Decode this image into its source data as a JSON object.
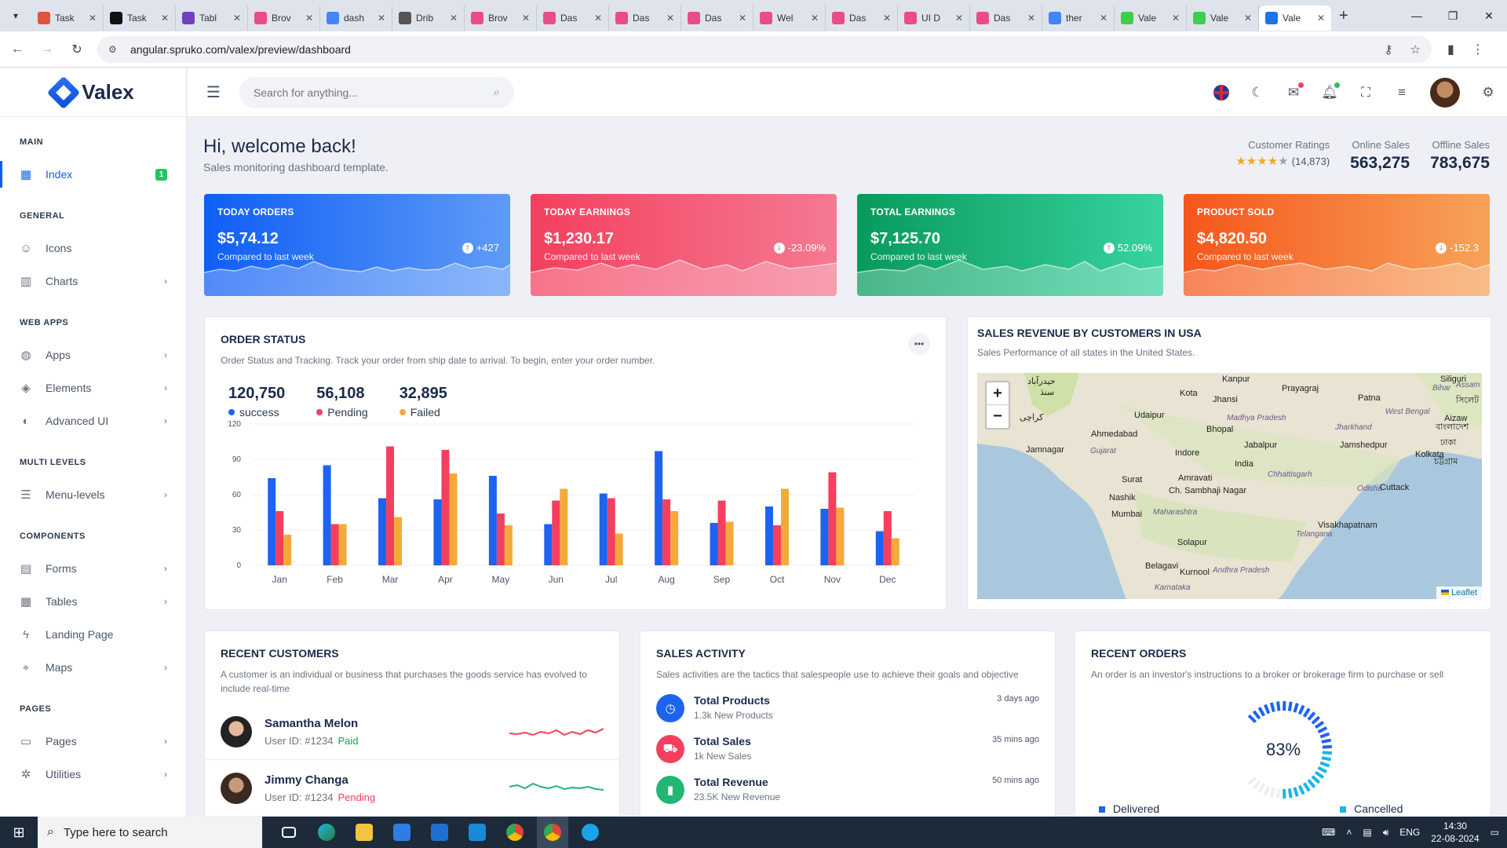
{
  "browser": {
    "tabs": [
      {
        "title": "Task",
        "color": "#e0533d"
      },
      {
        "title": "Task",
        "color": "#111111"
      },
      {
        "title": "Tabl",
        "color": "#6f42c1"
      },
      {
        "title": "Brov",
        "color": "#ea4c89"
      },
      {
        "title": "dash",
        "color": "#4285f4"
      },
      {
        "title": "Drib",
        "color": "#555555"
      },
      {
        "title": "Brov",
        "color": "#ea4c89"
      },
      {
        "title": "Das",
        "color": "#ea4c89"
      },
      {
        "title": "Das",
        "color": "#ea4c89"
      },
      {
        "title": "Das",
        "color": "#ea4c89"
      },
      {
        "title": "Wel",
        "color": "#ea4c89"
      },
      {
        "title": "Das",
        "color": "#ea4c89"
      },
      {
        "title": "UI D",
        "color": "#ea4c89"
      },
      {
        "title": "Das",
        "color": "#ea4c89"
      },
      {
        "title": "ther",
        "color": "#4285f4"
      },
      {
        "title": "Vale",
        "color": "#3ecf4a"
      },
      {
        "title": "Vale",
        "color": "#3ecf4a"
      },
      {
        "title": "Vale",
        "color": "#1a73e8",
        "active": true
      }
    ],
    "url": "angular.spruko.com/valex/preview/dashboard"
  },
  "sidebar": {
    "logo": "Valex",
    "sections": [
      {
        "title": "MAIN",
        "items": [
          {
            "label": "Index",
            "icon": "grid-icon",
            "active": true,
            "badge": "1"
          }
        ]
      },
      {
        "title": "GENERAL",
        "items": [
          {
            "label": "Icons",
            "icon": "smile-icon"
          },
          {
            "label": "Charts",
            "icon": "chart-icon",
            "chevron": true
          }
        ]
      },
      {
        "title": "WEB APPS",
        "items": [
          {
            "label": "Apps",
            "icon": "globe-icon",
            "chevron": true
          },
          {
            "label": "Elements",
            "icon": "layers-icon",
            "chevron": true
          },
          {
            "label": "Advanced UI",
            "icon": "palette-icon",
            "chevron": true
          }
        ]
      },
      {
        "title": "MULTI LEVELS",
        "items": [
          {
            "label": "Menu-levels",
            "icon": "server-icon",
            "chevron": true
          }
        ]
      },
      {
        "title": "COMPONENTS",
        "items": [
          {
            "label": "Forms",
            "icon": "file-icon",
            "chevron": true
          },
          {
            "label": "Tables",
            "icon": "table-icon",
            "chevron": true
          },
          {
            "label": "Landing Page",
            "icon": "bolt-icon"
          },
          {
            "label": "Maps",
            "icon": "pin-icon",
            "chevron": true
          }
        ]
      },
      {
        "title": "PAGES",
        "items": [
          {
            "label": "Pages",
            "icon": "book-icon",
            "chevron": true
          },
          {
            "label": "Utilities",
            "icon": "settings-icon",
            "chevron": true
          }
        ]
      }
    ]
  },
  "topbar": {
    "search_placeholder": "Search for anything..."
  },
  "header": {
    "title": "Hi, welcome back!",
    "subtitle": "Sales monitoring dashboard template.",
    "ratings_label": "Customer Ratings",
    "ratings_count": "(14,873)",
    "online_label": "Online Sales",
    "online_value": "563,275",
    "offline_label": "Offline Sales",
    "offline_value": "783,675"
  },
  "cards": [
    {
      "title": "TODAY ORDERS",
      "value": "$5,74.12",
      "sub": "Compared to last week",
      "delta": "+427",
      "dir": "up"
    },
    {
      "title": "TODAY EARNINGS",
      "value": "$1,230.17",
      "sub": "Compared to last week",
      "delta": "-23.09%",
      "dir": "down"
    },
    {
      "title": "TOTAL EARNINGS",
      "value": "$7,125.70",
      "sub": "Compared to last week",
      "delta": "52.09%",
      "dir": "up"
    },
    {
      "title": "PRODUCT SOLD",
      "value": "$4,820.50",
      "sub": "Compared to last week",
      "delta": "-152.3",
      "dir": "down"
    }
  ],
  "order_status": {
    "title": "ORDER STATUS",
    "desc": "Order Status and Tracking. Track your order from ship date to arrival. To begin, enter your order number.",
    "stats": [
      {
        "value": "120,750",
        "label": "success",
        "color": "#1e63f0"
      },
      {
        "value": "56,108",
        "label": "Pending",
        "color": "#f43f5e"
      },
      {
        "value": "32,895",
        "label": "Failed",
        "color": "#f6a93b"
      }
    ]
  },
  "chart_data": {
    "type": "bar",
    "categories": [
      "Jan",
      "Feb",
      "Mar",
      "Apr",
      "May",
      "Jun",
      "Jul",
      "Aug",
      "Sep",
      "Oct",
      "Nov",
      "Dec"
    ],
    "series": [
      {
        "name": "success",
        "color": "#1e63f0",
        "values": [
          74,
          85,
          57,
          56,
          76,
          35,
          61,
          97,
          36,
          50,
          48,
          29
        ]
      },
      {
        "name": "Pending",
        "color": "#f43f5e",
        "values": [
          46,
          35,
          101,
          98,
          44,
          55,
          57,
          56,
          55,
          34,
          79,
          46
        ]
      },
      {
        "name": "Failed",
        "color": "#f6a93b",
        "values": [
          26,
          35,
          41,
          78,
          34,
          65,
          27,
          46,
          37,
          65,
          49,
          23
        ]
      }
    ],
    "yticks": [
      0,
      30,
      60,
      90,
      120
    ],
    "ylim": [
      0,
      120
    ]
  },
  "map": {
    "title": "SALES REVENUE BY CUSTOMERS IN USA",
    "desc": "Sales Performance of all states in the United States.",
    "attribution": "Leaflet",
    "cities": [
      {
        "name": "Kanpur",
        "it": false
      },
      {
        "name": "Prayagraj",
        "it": false
      },
      {
        "name": "Siliguri",
        "it": false
      },
      {
        "name": "Assam",
        "it": true
      },
      {
        "name": "Bihar",
        "it": true
      },
      {
        "name": "Kota",
        "it": false
      },
      {
        "name": "Jhansi",
        "it": false
      },
      {
        "name": "Patna",
        "it": false
      },
      {
        "name": "সিলেট",
        "it": false
      },
      {
        "name": "Udaipur",
        "it": false
      },
      {
        "name": "Madhya Pradesh",
        "it": true
      },
      {
        "name": "Ahmedabad",
        "it": false
      },
      {
        "name": "Bhopal",
        "it": false
      },
      {
        "name": "Jharkhand",
        "it": true
      },
      {
        "name": "West Bengal",
        "it": true
      },
      {
        "name": "Jamnagar",
        "it": false
      },
      {
        "name": "Indore",
        "it": false
      },
      {
        "name": "Jabalpur",
        "it": false
      },
      {
        "name": "Jamshedpur",
        "it": false
      },
      {
        "name": "Kolkata",
        "it": false
      },
      {
        "name": "Gujarat",
        "it": true
      },
      {
        "name": "India",
        "it": false
      },
      {
        "name": "Amravati",
        "it": false
      },
      {
        "name": "Surat",
        "it": false
      },
      {
        "name": "Chhattisgarh",
        "it": true
      },
      {
        "name": "Nashik",
        "it": false
      },
      {
        "name": "Ch. Sambhaji Nagar",
        "it": false
      },
      {
        "name": "Odisha",
        "it": true
      },
      {
        "name": "Cuttack",
        "it": false
      },
      {
        "name": "Mumbai",
        "it": false
      },
      {
        "name": "Maharashtra",
        "it": true
      },
      {
        "name": "Telangana",
        "it": true
      },
      {
        "name": "Visakhapatnam",
        "it": false
      },
      {
        "name": "Solapur",
        "it": false
      },
      {
        "name": "Belagavi",
        "it": false
      },
      {
        "name": "Kurnool",
        "it": false
      },
      {
        "name": "Andhra Pradesh",
        "it": true
      },
      {
        "name": "Karnataka",
        "it": true
      },
      {
        "name": "حیدرآباد",
        "it": false
      },
      {
        "name": "سنڌ",
        "it": false
      },
      {
        "name": "کراچی",
        "it": false
      },
      {
        "name": "Aizaw",
        "it": false
      },
      {
        "name": "চট্টগ্রাম",
        "it": false
      },
      {
        "name": "ঢাকা",
        "it": false
      },
      {
        "name": "বাংলাদেশ",
        "it": false
      }
    ]
  },
  "customers": {
    "title": "RECENT CUSTOMERS",
    "desc": "A customer is an individual or business that purchases the goods service has evolved to include real-time",
    "rows": [
      {
        "name": "Samantha Melon",
        "id": "User ID: #1234",
        "status": "Paid",
        "color": "#f43f5e"
      },
      {
        "name": "Jimmy Changa",
        "id": "User ID: #1234",
        "status": "Pending",
        "color": "#22b573"
      }
    ]
  },
  "activity": {
    "title": "SALES ACTIVITY",
    "desc": "Sales activities are the tactics that salespeople use to achieve their goals and objective",
    "rows": [
      {
        "title": "Total Products",
        "sub": "1.3k New Products",
        "time": "3 days ago",
        "color": "#1e63f0",
        "icon": "clock-icon"
      },
      {
        "title": "Total Sales",
        "sub": "1k New Sales",
        "time": "35 mins ago",
        "color": "#f43f5e",
        "icon": "cart-icon"
      },
      {
        "title": "Total Revenue",
        "sub": "23.5K New Revenue",
        "time": "50 mins ago",
        "color": "#22b573",
        "icon": "bar-chart-icon"
      }
    ]
  },
  "orders": {
    "title": "RECENT ORDERS",
    "desc": "An order is an investor's instructions to a broker or brokerage firm to purchase or sell",
    "percent": "83%",
    "percent_value": 83,
    "legend": [
      {
        "label": "Delivered",
        "color": "#1e63f0"
      },
      {
        "label": "Cancelled",
        "color": "#19b5e8"
      }
    ]
  },
  "taskbar": {
    "search_placeholder": "Type here to search",
    "lang": "ENG",
    "time": "14:30",
    "date": "22-08-2024"
  }
}
